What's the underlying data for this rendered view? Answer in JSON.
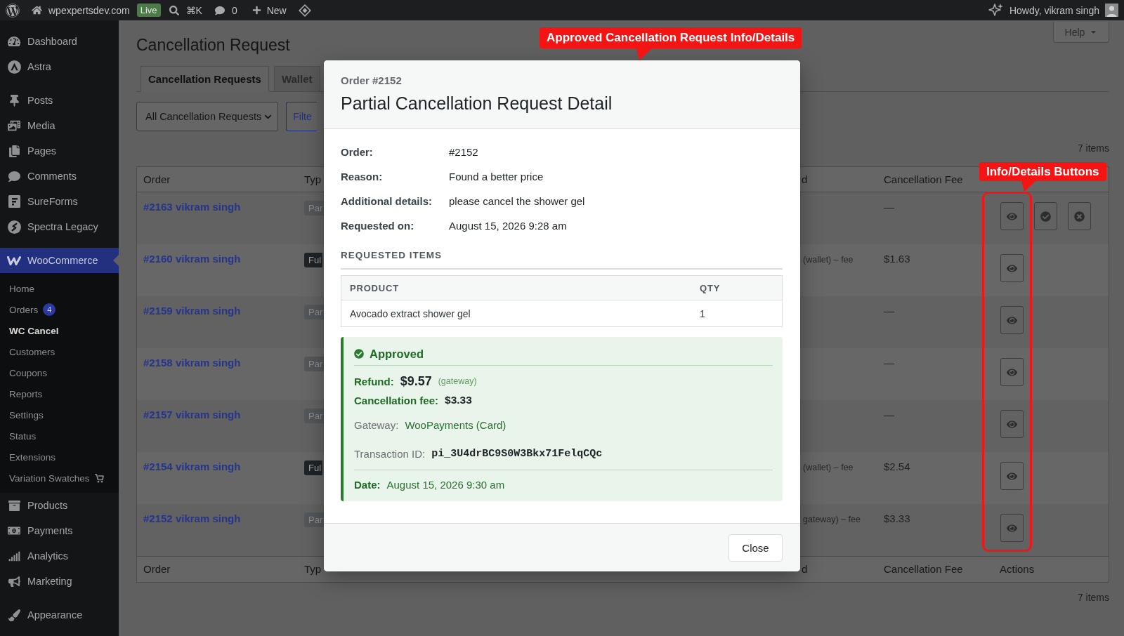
{
  "admin_bar": {
    "site_name": "wpexpertsdev.com",
    "site_badge": "Live",
    "search_shortcut": "⌘K",
    "comment_count": "0",
    "new_label": "New",
    "greeting": "Howdy, vikram singh"
  },
  "sidebar": {
    "groups": [
      {
        "items": [
          {
            "label": "Dashboard",
            "selected": false
          },
          {
            "label": "Astra",
            "selected": false
          }
        ]
      },
      {
        "items": [
          {
            "label": "Posts",
            "selected": false
          },
          {
            "label": "Media",
            "selected": false
          },
          {
            "label": "Pages",
            "selected": false
          },
          {
            "label": "Comments",
            "selected": false
          },
          {
            "label": "SureForms",
            "selected": false
          },
          {
            "label": "Spectra Legacy",
            "selected": false
          }
        ]
      },
      {
        "items": [
          {
            "label": "WooCommerce",
            "selected": true,
            "children": [
              {
                "label": "Home",
                "selected": false
              },
              {
                "label": "Orders",
                "badge": "4",
                "selected": false
              },
              {
                "label": "WC Cancel",
                "selected": true
              },
              {
                "label": "Customers",
                "selected": false
              },
              {
                "label": "Coupons",
                "selected": false
              },
              {
                "label": "Reports",
                "selected": false
              },
              {
                "label": "Settings",
                "selected": false
              },
              {
                "label": "Status",
                "selected": false
              },
              {
                "label": "Extensions",
                "selected": false
              },
              {
                "label": "Variation Swatches",
                "selected": false
              }
            ]
          },
          {
            "label": "Products",
            "selected": false
          },
          {
            "label": "Payments",
            "selected": false
          },
          {
            "label": "Analytics",
            "selected": false
          },
          {
            "label": "Marketing",
            "selected": false
          }
        ]
      },
      {
        "items": [
          {
            "label": "Appearance",
            "selected": false
          }
        ]
      }
    ]
  },
  "help_button": "Help",
  "page": {
    "title": "Cancellation Request",
    "tabs": [
      {
        "label": "Cancellation Requests",
        "selected": true
      },
      {
        "label": "Wallet",
        "selected": false
      }
    ],
    "filter_select": "All Cancellation Requests",
    "filter_button": "Filte",
    "count_top": "7 items",
    "count_bottom": "7 items"
  },
  "table": {
    "header": {
      "order": "Order",
      "type": "Typ",
      "column_3": "d",
      "cancellation_fee": "Cancellation Fee"
    },
    "rows": [
      {
        "order": "#2163 vikram singh",
        "type": {
          "label": "Par",
          "kind": "partial"
        },
        "cancellation_fee": "—",
        "actions": [
          {
            "kind": "view"
          },
          {
            "kind": "approve"
          },
          {
            "kind": "reject"
          }
        ]
      },
      {
        "order": "#2160 vikram singh",
        "type": {
          "label": "Ful",
          "kind": "full"
        },
        "column_3": "(wallet) – fee",
        "cancellation_fee": "$1.63",
        "actions": [
          {
            "kind": "view"
          }
        ]
      },
      {
        "order": "#2159 vikram singh",
        "type": {
          "label": "Par",
          "kind": "partial"
        },
        "cancellation_fee": "—",
        "actions": [
          {
            "kind": "view"
          }
        ]
      },
      {
        "order": "#2158 vikram singh",
        "type": {
          "label": "Par",
          "kind": "partial"
        },
        "cancellation_fee": "—",
        "actions": [
          {
            "kind": "view"
          }
        ]
      },
      {
        "order": "#2157 vikram singh",
        "type": {
          "label": "Par",
          "kind": "partial"
        },
        "cancellation_fee": "—",
        "actions": [
          {
            "kind": "view"
          }
        ]
      },
      {
        "order": "#2154 vikram singh",
        "type": {
          "label": "Ful",
          "kind": "full"
        },
        "column_3": "(wallet) – fee",
        "cancellation_fee": "$2.54",
        "actions": [
          {
            "kind": "view"
          }
        ]
      },
      {
        "order": "#2152 vikram singh",
        "type": {
          "label": "Par",
          "kind": "partial"
        },
        "column_3": "gateway) – fee",
        "cancellation_fee": "$3.33",
        "actions": [
          {
            "kind": "view"
          }
        ]
      }
    ],
    "footer": {
      "order": "Order",
      "type": "Typ",
      "column_3": "d",
      "cancellation_fee": "Cancellation Fee",
      "actions": "Actions"
    }
  },
  "modal": {
    "subtitle": "Order #2152",
    "title": "Partial Cancellation Request Detail",
    "fields": [
      {
        "label": "Order:",
        "value": "#2152"
      },
      {
        "label": "Reason:",
        "value": "Found a better price"
      },
      {
        "label": "Additional details:",
        "value": "please cancel the shower gel"
      },
      {
        "label": "Requested on:",
        "value": "August 15, 2026 9:28 am"
      }
    ],
    "items_heading": "REQUESTED ITEMS",
    "items_table": {
      "columns": [
        "PRODUCT",
        "QTY"
      ],
      "rows": [
        [
          "Avocado extract shower gel",
          "1"
        ]
      ]
    },
    "status": {
      "kind": "approved",
      "label": "Approved",
      "refund_label": "Refund:",
      "refund_amount": "$9.57",
      "refund_method": "(gateway)",
      "fee_label": "Cancellation fee:",
      "fee_amount": "$3.33",
      "gateway_label": "Gateway:",
      "gateway_value": "WooPayments (Card)",
      "transaction_label": "Transaction ID:",
      "transaction_id": "pi_3U4drBC9S0W3Bkx71FelqCQc",
      "date_label": "Date:",
      "date_value": "August 15, 2026 9:30 am"
    },
    "close_button": "Close"
  },
  "annotations": [
    {
      "text": "Approved Cancellation Request Info/Details"
    },
    {
      "text": "Info/Details Buttons"
    }
  ]
}
